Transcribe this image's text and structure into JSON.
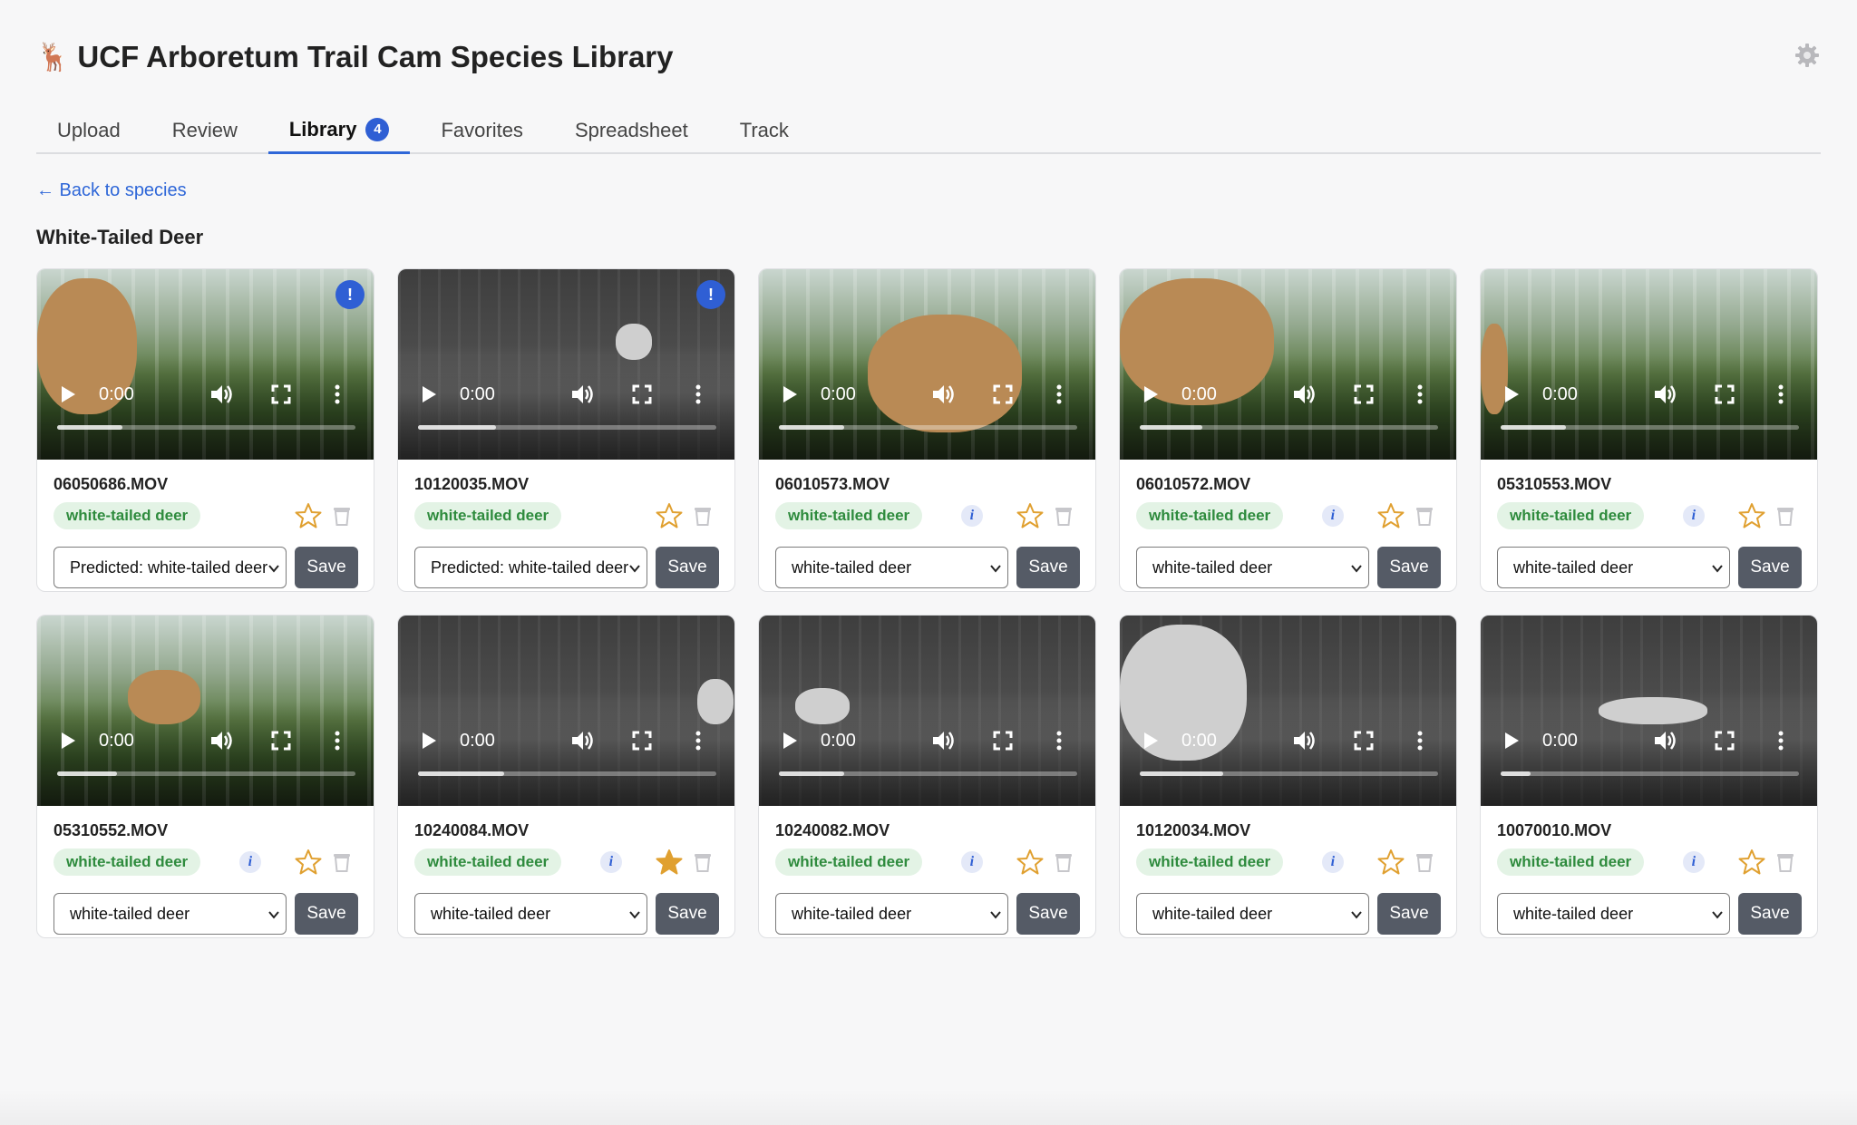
{
  "app": {
    "title": "UCF Arboretum Trail Cam Species Library",
    "title_icon": "🦌"
  },
  "tabs": [
    {
      "label": "Upload",
      "active": false
    },
    {
      "label": "Review",
      "active": false
    },
    {
      "label": "Library",
      "active": true,
      "badge": "4"
    },
    {
      "label": "Favorites",
      "active": false
    },
    {
      "label": "Spreadsheet",
      "active": false
    },
    {
      "label": "Track",
      "active": false
    }
  ],
  "back_link": "← Back to species",
  "section_title": "White-Tailed Deer",
  "colors": {
    "accent": "#2f5fd4",
    "chip_bg": "#e3f3e5",
    "chip_text": "#2e8b3d",
    "star": "#e0a030",
    "save_button": "#555b66"
  },
  "save_label": "Save",
  "cards": [
    {
      "filename": "06050686.MOV",
      "species": "white-tailed deer",
      "select_value": "Predicted: white-tailed deer",
      "time": "0:00",
      "starred": false,
      "has_info": false,
      "alert": "!",
      "mode": "color",
      "progress": 0.22
    },
    {
      "filename": "10120035.MOV",
      "species": "white-tailed deer",
      "select_value": "Predicted: white-tailed deer",
      "time": "0:00",
      "starred": false,
      "has_info": false,
      "alert": "!",
      "mode": "ir",
      "progress": 0.26
    },
    {
      "filename": "06010573.MOV",
      "species": "white-tailed deer",
      "select_value": "white-tailed deer",
      "time": "0:00",
      "starred": false,
      "has_info": true,
      "alert": "",
      "mode": "color",
      "progress": 0.22
    },
    {
      "filename": "06010572.MOV",
      "species": "white-tailed deer",
      "select_value": "white-tailed deer",
      "time": "0:00",
      "starred": false,
      "has_info": true,
      "alert": "",
      "mode": "color",
      "progress": 0.21
    },
    {
      "filename": "05310553.MOV",
      "species": "white-tailed deer",
      "select_value": "white-tailed deer",
      "time": "0:00",
      "starred": false,
      "has_info": true,
      "alert": "",
      "mode": "color",
      "progress": 0.22
    },
    {
      "filename": "05310552.MOV",
      "species": "white-tailed deer",
      "select_value": "white-tailed deer",
      "time": "0:00",
      "starred": false,
      "has_info": true,
      "alert": "",
      "mode": "color",
      "progress": 0.2
    },
    {
      "filename": "10240084.MOV",
      "species": "white-tailed deer",
      "select_value": "white-tailed deer",
      "time": "0:00",
      "starred": true,
      "has_info": true,
      "alert": "",
      "mode": "ir",
      "progress": 0.29
    },
    {
      "filename": "10240082.MOV",
      "species": "white-tailed deer",
      "select_value": "white-tailed deer",
      "time": "0:00",
      "starred": false,
      "has_info": true,
      "alert": "",
      "mode": "ir",
      "progress": 0.22
    },
    {
      "filename": "10120034.MOV",
      "species": "white-tailed deer",
      "select_value": "white-tailed deer",
      "time": "0:00",
      "starred": false,
      "has_info": true,
      "alert": "",
      "mode": "ir",
      "progress": 0.28
    },
    {
      "filename": "10070010.MOV",
      "species": "white-tailed deer",
      "select_value": "white-tailed deer",
      "time": "0:00",
      "starred": false,
      "has_info": true,
      "alert": "",
      "mode": "ir",
      "progress": 0.1
    }
  ]
}
